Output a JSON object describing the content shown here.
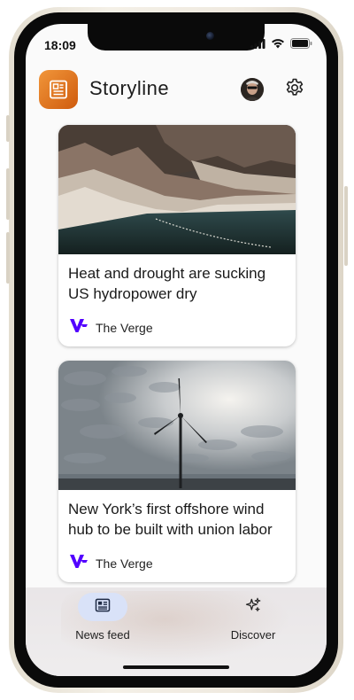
{
  "status_bar": {
    "time": "18:09"
  },
  "app": {
    "title": "Storyline"
  },
  "icons": {
    "logo": "newspaper-icon",
    "settings": "gear-icon",
    "avatar": "user-avatar",
    "news_feed": "newspaper-icon",
    "discover": "sparkles-icon",
    "source": "the-verge-logo"
  },
  "colors": {
    "accent": "#e07a1f",
    "nav_active": "#d9e2f8",
    "verge_purple": "#5200ff"
  },
  "feed": {
    "articles": [
      {
        "title": "Heat and drought are sucking US hydropower dry",
        "source": "The Verge",
        "image": "canyon-reservoir"
      },
      {
        "title": "New York’s first offshore wind hub to be built with union labor",
        "source": "The Verge",
        "image": "wind-turbine-sky"
      }
    ]
  },
  "bottom_nav": {
    "items": [
      {
        "label": "News feed",
        "active": true
      },
      {
        "label": "Discover",
        "active": false
      }
    ]
  }
}
